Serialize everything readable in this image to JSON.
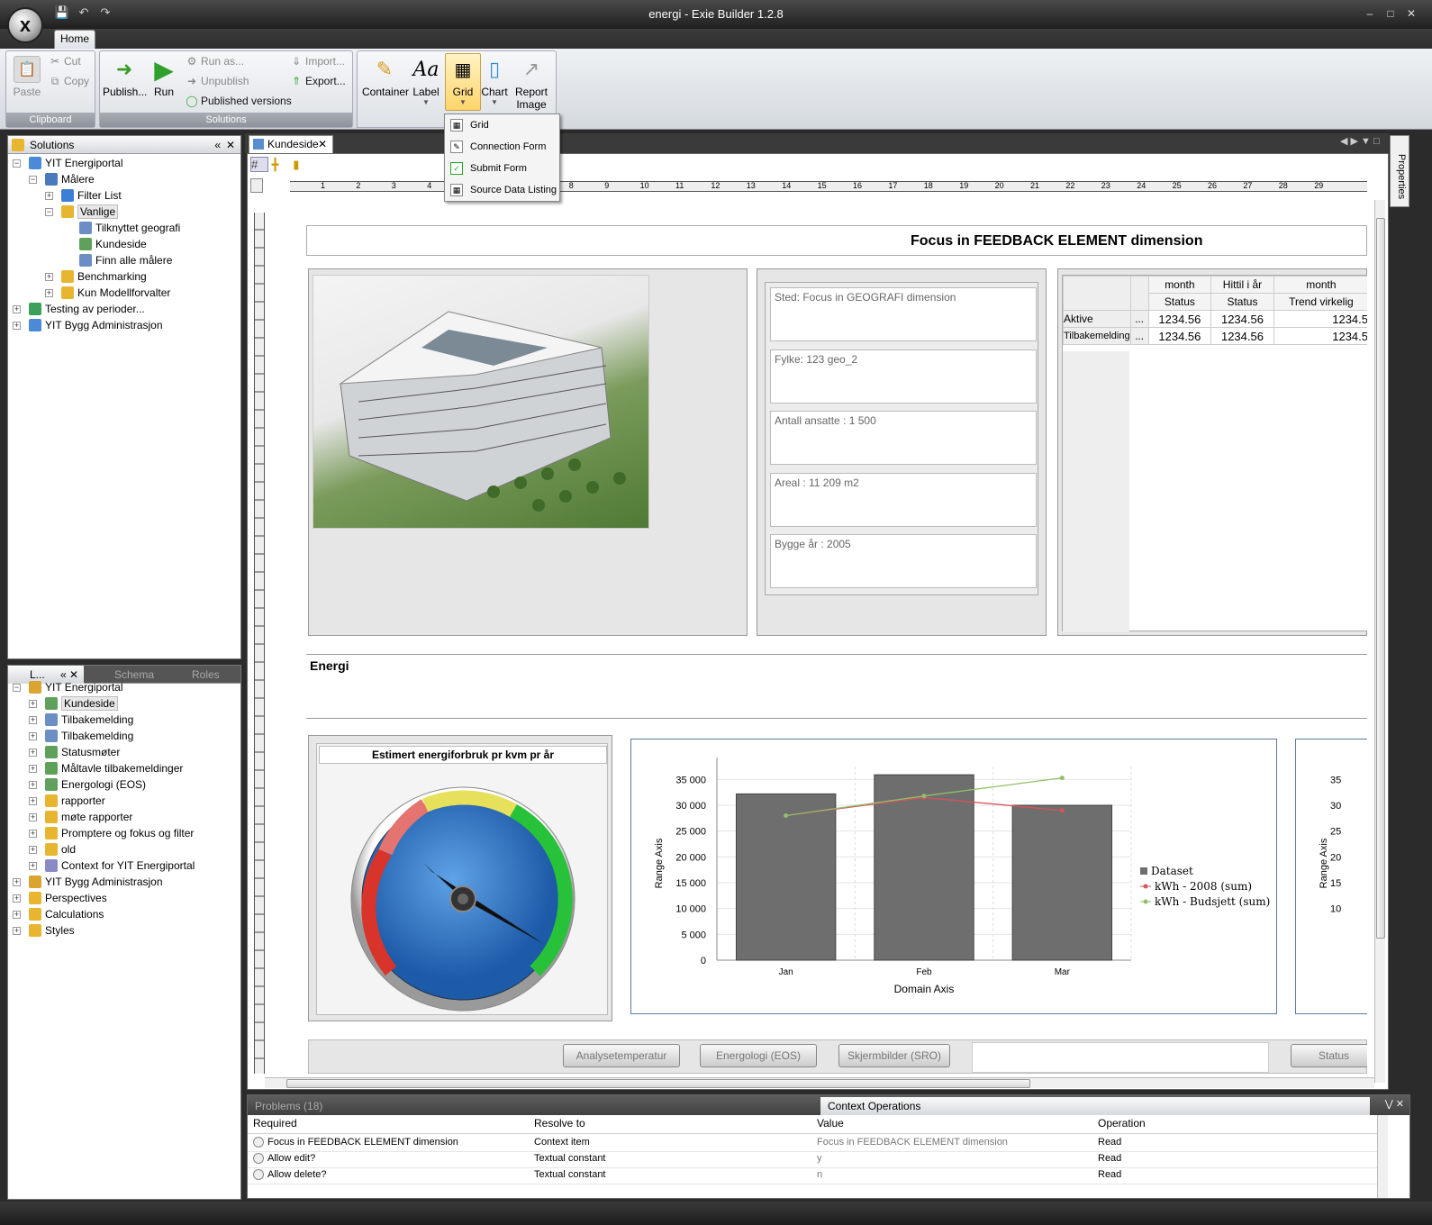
{
  "window": {
    "title": "energi - Exie Builder 1.2.8"
  },
  "ribbon": {
    "tab_home": "Home",
    "clipboard": {
      "label": "Clipboard",
      "paste": "Paste",
      "cut": "Cut",
      "copy": "Copy"
    },
    "solutions": {
      "label": "Solutions",
      "publish": "Publish...",
      "run": "Run",
      "run_as": "Run as...",
      "unpublish": "Unpublish",
      "published_versions": "Published versions",
      "import": "Import...",
      "export": "Export..."
    },
    "insert": {
      "container": "Container",
      "label": "Label",
      "grid": "Grid",
      "chart": "Chart",
      "report_image": "Report\nImage"
    }
  },
  "grid_menu": [
    "Grid",
    "Connection Form",
    "Submit Form",
    "Source Data Listing"
  ],
  "solutions_panel": {
    "title": "Solutions",
    "items": [
      "YIT Energiportal",
      "Målere",
      "Filter List",
      "Vanlige",
      "Tilknyttet geografi",
      "Kundeside",
      "Finn alle målere",
      "Benchmarking",
      "Kun Modellforvalter",
      "Testing av perioder...",
      "YIT Bygg Administrasjon"
    ]
  },
  "layout_panel": {
    "tabs": [
      "L...",
      "Schema",
      "Roles"
    ],
    "items": [
      "YIT Energiportal",
      "Kundeside",
      "Tilbakemelding",
      "Tilbakemelding",
      "Statusmøter",
      "Måltavle tilbakemeldinger",
      "Energologi (EOS)",
      "rapporter",
      "møte rapporter",
      "Promptere og fokus og filter",
      "old",
      "Context for YIT Energiportal",
      "YIT Bygg Administrasjon",
      "Perspectives",
      "Calculations",
      "Styles"
    ]
  },
  "document": {
    "tab": "Kundeside",
    "ruler_ticks": [
      "1",
      "2",
      "3",
      "4",
      "5",
      "6",
      "7",
      "8",
      "9",
      "10",
      "11",
      "12",
      "13",
      "14",
      "15",
      "16",
      "17",
      "18",
      "19",
      "20",
      "21",
      "22",
      "23",
      "24",
      "25",
      "26",
      "27",
      "28",
      "29"
    ],
    "header_title": "Focus in FEEDBACK ELEMENT dimension",
    "info": [
      "Sted: Focus in GEOGRAFI dimension",
      "Fylke: 123 geo_2",
      "Antall ansatte : 1 500",
      "Areal : 11 209 m2",
      "Bygge år : 2005"
    ],
    "grid": {
      "head1": [
        "month",
        "Hittil i år",
        "month"
      ],
      "head2": [
        "Status",
        "Status",
        "Trend virkelig"
      ],
      "rows": [
        {
          "label": "Aktive",
          "dots": "...",
          "v1": "1234.56",
          "v2": "1234.56",
          "v3": "1234.5"
        },
        {
          "label": "Tilbakemelding",
          "dots": "...",
          "v1": "1234.56",
          "v2": "1234.56",
          "v3": "1234.5"
        }
      ]
    },
    "energi_label": "Energi",
    "gauge_title": "Estimert energiforbruk pr kvm pr år",
    "tabs_bottom": [
      "Analysetemperatur",
      "Energologi (EOS)",
      "Skjermbilder (SRO)",
      "Status"
    ]
  },
  "chart_data": {
    "type": "bar",
    "categories": [
      "Jan",
      "Feb",
      "Mar"
    ],
    "series": [
      {
        "name": "Dataset",
        "values": [
          32200,
          35900,
          30000
        ]
      },
      {
        "name": "kWh - 2008 (sum)",
        "values": [
          28000,
          31500,
          29000
        ]
      },
      {
        "name": "kWh - Budsjett (sum)",
        "values": [
          28000,
          31800,
          35300
        ]
      }
    ],
    "xlabel": "Domain Axis",
    "ylabel": "Range Axis",
    "yticks": [
      "35 000",
      "30 000",
      "25 000",
      "20 000",
      "15 000",
      "10 000",
      "5 000",
      "0"
    ],
    "ylim": [
      0,
      37500
    ],
    "legend": "right",
    "colors": {
      "bar": "#6e6e6e",
      "line2008": "#d9535a",
      "lineBudget": "#8ec06c"
    }
  },
  "bottom_panel": {
    "tabs": [
      "Problems (18)",
      "Context Operations"
    ],
    "columns": [
      "Required",
      "Resolve to",
      "Value",
      "Operation"
    ],
    "rows": [
      {
        "required": "Focus in FEEDBACK ELEMENT dimension",
        "resolve": "Context item",
        "value": "Focus in FEEDBACK ELEMENT dimension",
        "op": "Read"
      },
      {
        "required": "Allow edit?",
        "resolve": "Textual constant",
        "value": "y",
        "op": "Read"
      },
      {
        "required": "Allow delete?",
        "resolve": "Textual constant",
        "value": "n",
        "op": "Read"
      }
    ]
  },
  "properties_label": "Properties"
}
